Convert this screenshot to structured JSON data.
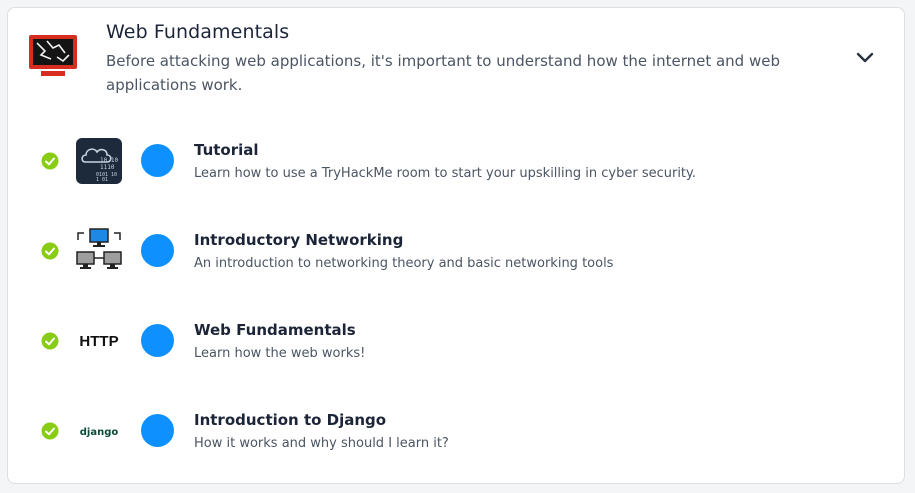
{
  "module": {
    "title": "Web Fundamentals",
    "description": "Before attacking web applications, it's important to understand how the internet and web applications work.",
    "icon": "broken-monitor-icon",
    "expand_icon": "chevron-down-icon"
  },
  "rooms": [
    {
      "title": "Tutorial",
      "description": "Learn how to use a TryHackMe room to start your upskilling in cyber security.",
      "icon": "cloud-binary-icon",
      "completed": true
    },
    {
      "title": "Introductory Networking",
      "description": "An introduction to networking theory and basic networking tools",
      "icon": "network-computers-icon",
      "completed": true
    },
    {
      "title": "Web Fundamentals",
      "description": "Learn how the web works!",
      "icon": "http-text-icon",
      "icon_text": "HTTP",
      "completed": true
    },
    {
      "title": "Introduction to Django",
      "description": "How it works and why should I learn it?",
      "icon": "django-logo-icon",
      "icon_text": "django",
      "completed": true
    }
  ],
  "colors": {
    "accent_blue": "#0e91ff",
    "check_green": "#88cc14",
    "heading": "#1c2538",
    "body_text": "#4b5563"
  }
}
